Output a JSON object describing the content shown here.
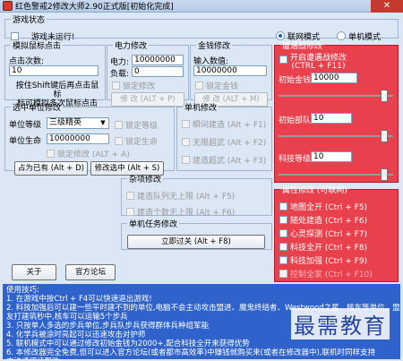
{
  "window": {
    "title": "红色警戒2修改大师2.90正式版[初始化完成]",
    "close_glyph": "✕"
  },
  "game_status": {
    "legend": "游戏状态",
    "status_text": "游戏未运行!",
    "mode_online": "联网模式",
    "mode_single": "单机模式",
    "selected_mode": "online"
  },
  "mouse_click": {
    "legend": "模拟鼠标点击",
    "count_label": "点击次数:",
    "count_value": "10",
    "hint": "按住Shift键后再点击鼠标\n标可模拟多次鼠标点击"
  },
  "power": {
    "legend": "电力修改",
    "power_label": "电力:",
    "power_value": "10000000",
    "load_label": "负载:",
    "load_value": "0",
    "lock_label": "锁定修改",
    "button_label": "修 改 (ALT + P)"
  },
  "money": {
    "legend": "金钱修改",
    "input_label": "输入数值:",
    "input_value": "10000000",
    "lock_label": "锁定金钱",
    "button_label": "修 改 (ALT + M)"
  },
  "selected_unit": {
    "legend": "选中单位修改",
    "level_label": "单位等级",
    "level_value": "三级精英",
    "level_lock": "锁定等级",
    "hp_label": "单位生命",
    "hp_value": "10000000",
    "hp_lock": "锁定生命",
    "invincible_label": "锁定修改 (ALT + A)",
    "own_button": "占为已有 (Alt + D)",
    "modify_button": "修改选中 (Alt + S)"
  },
  "unit_mod": {
    "legend": "单机修改",
    "items": [
      "瞬间建造 (Alt + F1)",
      "无限超武 (Alt + F2)",
      "建造超武 (Alt + F3)"
    ]
  },
  "misc": {
    "legend": "杂项修改",
    "items": [
      "建造队列无上限 (Alt + F5)",
      "建造个数无上限 (Alt + F6)"
    ]
  },
  "single_task": {
    "legend": "单机任务修改",
    "button_label": "立即过关 (Alt + F8)"
  },
  "battle_mod": {
    "legend": "遭遇战修改",
    "enable_label": "开启遭遇战修改\n(CTRL + F11)",
    "initial_money_label": "初始金钱",
    "initial_money_value": "10000",
    "initial_units_label": "初始部队",
    "initial_units_value": "10",
    "tech_level_label": "科技等级",
    "tech_level_value": "10",
    "money_slider": 0.95,
    "units_slider": 0.95,
    "tech_slider": 0.95
  },
  "attr_mod": {
    "legend": "属性修改 (可联网)",
    "items": [
      {
        "label": "地图全开 (Ctrl + F5)",
        "enabled": true
      },
      {
        "label": "随处建造 (Ctrl + F6)",
        "enabled": true
      },
      {
        "label": "心灵探测 (Ctrl + F7)",
        "enabled": true
      },
      {
        "label": "科技全开 (Ctrl + F8)",
        "enabled": true
      },
      {
        "label": "科技加强 (Ctrl + F9)",
        "enabled": true
      },
      {
        "label": "控制全家 (Ctrl + F10)",
        "enabled": false
      }
    ]
  },
  "footer": {
    "about_button": "关于",
    "forum_button": "官方论坛"
  },
  "tips": {
    "title": "使用技巧:",
    "lines": [
      "1. 在游戏中按Ctrl + F4可以快速退出游戏!",
      "2. 科技加强后可以建一些平时建不到的单位,电脑不会主动攻击盟进、魔鬼终结者、Westwood之星、核车等单位。盟",
      "友打建筑秒中,核车可以运输5个步兵",
      "3. 只按单人多选的步兵单位,步兵队步兵获得群体兵种组军能",
      "4. 化学兵被涂时亮起可以迅速攻击对护师",
      "5. 联机模式中可以通过修改初始金钱为2000+,配合科技全开来获得优势",
      "6. 本修改器完全免费,但可以进入官方论坛(或者都市高效率)中赚钱就购买来(或者在修改器中),联机时同样支持",
      "方法请阅读帮助"
    ]
  },
  "watermark": "最需教育"
}
